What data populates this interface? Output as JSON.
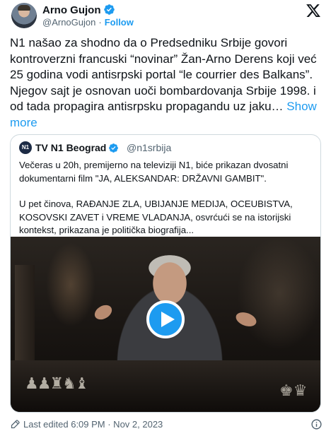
{
  "author": {
    "name": "Arno Gujon",
    "handle": "@ArnoGujon",
    "follow_label": "Follow",
    "separator": "·"
  },
  "tweet": {
    "text": "N1 našao za shodno da o Predsedniku Srbije govori kontroverzni francuski “novinar” Žan-Arno Derens koji već 25 godina vodi antisrpski portal “le courrier des Balkans”. Njegov sajt je osnovan uoči bombardovanja Srbije 1998. i od tada propagira antisrpsku propagandu uz jaku…",
    "show_more_label": "Show more"
  },
  "quote": {
    "logo_text": "N1",
    "name": "TV N1 Beograd",
    "handle": "@n1srbija",
    "paragraph1": "Večeras u 20h, premijerno na televiziji N1, biće prikazan dvosatni dokumentarni film \"JA, ALEKSANDAR: DRŽAVNI GAMBIT\".",
    "paragraph2": "U pet činova, RAĐANJE ZLA, UBIJANJE MEDIJA, OCEUBISTVA, KOSOVSKI ZAVET i VREME VLADANJA, osvrćući se na istorijski kontekst, prikazana je politička biografija..."
  },
  "footer": {
    "edited_text": "Last edited 6:09 PM · Nov 2, 2023"
  },
  "colors": {
    "accent": "#1d9bf0",
    "text": "#0f1419",
    "muted": "#536471",
    "border": "#cfd9de"
  },
  "icons": [
    "verified-badge-icon",
    "x-logo-icon",
    "play-icon",
    "edit-pencil-icon",
    "info-icon"
  ]
}
